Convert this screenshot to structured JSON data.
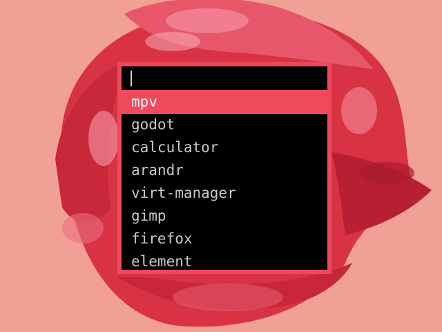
{
  "launcher": {
    "query": "",
    "selected_index": 0,
    "items": [
      {
        "label": "mpv"
      },
      {
        "label": "godot"
      },
      {
        "label": "calculator"
      },
      {
        "label": "arandr"
      },
      {
        "label": "virt-manager"
      },
      {
        "label": "gimp"
      },
      {
        "label": "firefox"
      },
      {
        "label": "element"
      }
    ]
  },
  "colors": {
    "accent": "#ee4a5c",
    "background": "#f1a095",
    "menu_bg": "#000000",
    "text": "#c9c9c9",
    "selected_text": "#ffffff"
  },
  "wallpaper": {
    "subject": "red-rose-illustration"
  }
}
